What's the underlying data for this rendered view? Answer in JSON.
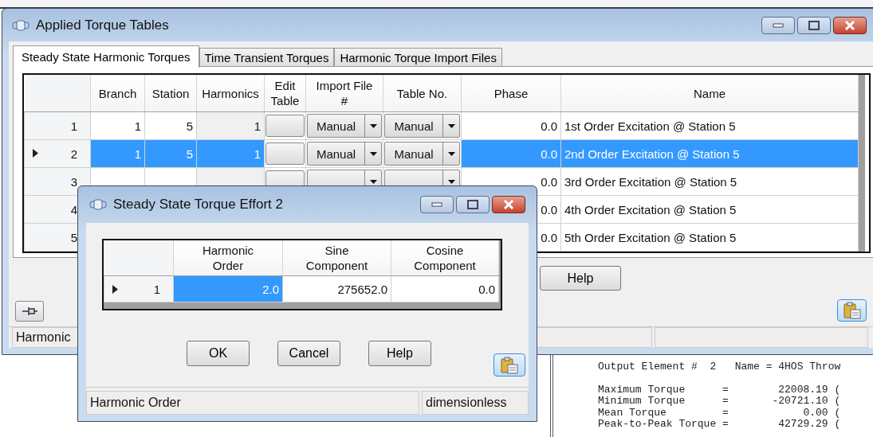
{
  "main_window": {
    "title": "Applied Torque Tables",
    "tabs": [
      {
        "label": "Steady State Harmonic Torques",
        "selected": true
      },
      {
        "label": "Time Transient Torques",
        "selected": false
      },
      {
        "label": "Harmonic Torque Import Files",
        "selected": false
      }
    ],
    "grid": {
      "columns": [
        "Branch",
        "Station",
        "Harmonics",
        "Edit\nTable",
        "Import File\n#",
        "Table No.",
        "Phase",
        "Name"
      ],
      "rows": [
        {
          "number": "1",
          "current": false,
          "selected": false,
          "branch": "1",
          "station": "5",
          "harmonics": "1",
          "import_file": "Manual",
          "table_no": "Manual",
          "phase": "0.0",
          "name": "1st Order Excitation @ Station 5"
        },
        {
          "number": "2",
          "current": true,
          "selected": true,
          "branch": "1",
          "station": "5",
          "harmonics": "1",
          "import_file": "Manual",
          "table_no": "Manual",
          "phase": "0.0",
          "name": "2nd Order Excitation @ Station 5"
        },
        {
          "number": "3",
          "current": false,
          "selected": false,
          "phase": "0.0",
          "name": "3rd Order Excitation @ Station 5"
        },
        {
          "number": "4",
          "current": false,
          "selected": false,
          "phase": "0.0",
          "name": "4th Order Excitation @ Station 5"
        },
        {
          "number": "5",
          "current": false,
          "selected": false,
          "phase": "0.0",
          "name": "5th Order Excitation @ Station 5"
        }
      ]
    },
    "help_button": "Help",
    "status_bar": [
      "Harmonic"
    ]
  },
  "dialog": {
    "title": "Steady State Torque Effort 2",
    "grid": {
      "columns": [
        "Harmonic\nOrder",
        "Sine\nComponent",
        "Cosine\nComponent"
      ],
      "rows": [
        {
          "number": "1",
          "current": true,
          "cells": [
            {
              "value": "2.0",
              "selected": true
            },
            {
              "value": "275652.0",
              "selected": false
            },
            {
              "value": "0.0",
              "selected": false
            }
          ]
        }
      ]
    },
    "buttons": [
      "OK",
      "Cancel",
      "Help"
    ],
    "status_bar": [
      "Harmonic Order",
      "dimensionless"
    ]
  },
  "output_text": {
    "header": "Output Element #  2   Name = 4HOS Throw",
    "lines": [
      "Maximum Torque      =        22008.19 (",
      "Minimum Torque      =       -20721.10 (",
      "Mean Torque         =            0.00 (",
      "Peak-to-Peak Torque =        42729.29 ("
    ]
  }
}
